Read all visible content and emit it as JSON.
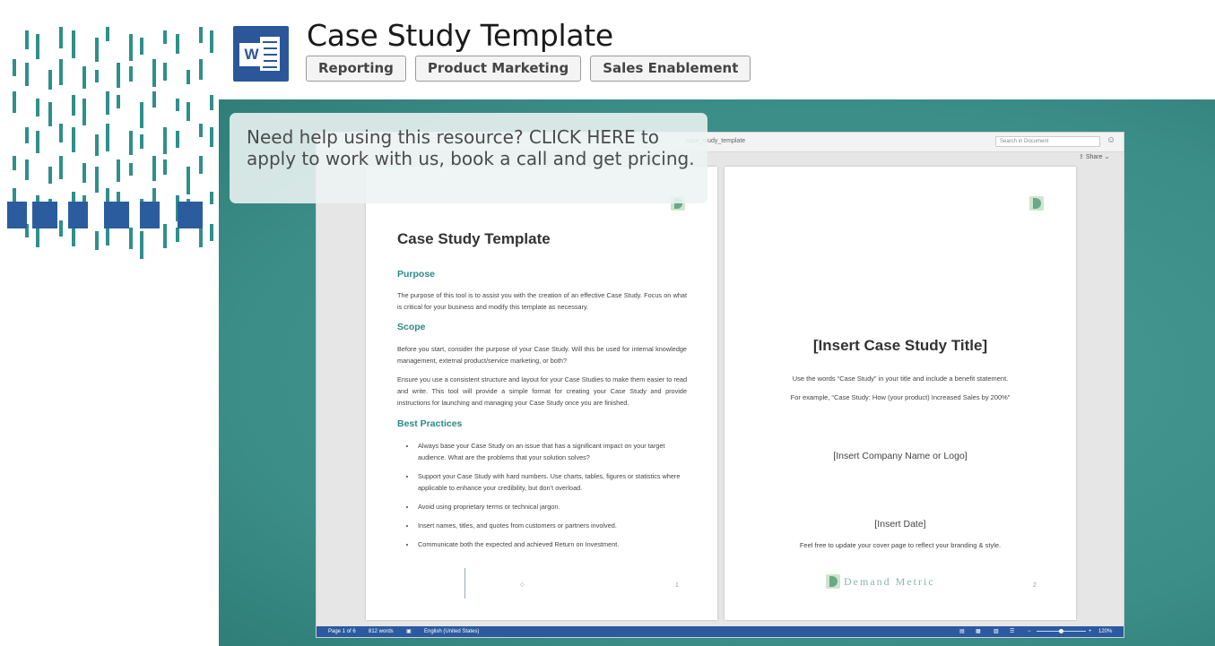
{
  "header": {
    "title": "Case Study Template",
    "tags": [
      "Reporting",
      "Product Marketing",
      "Sales Enablement"
    ],
    "app_icon": "word-icon",
    "app_icon_letter": "W"
  },
  "colors": {
    "accent_teal": "#3b8d87",
    "word_blue": "#2b579a",
    "heading_teal": "#2a8a86"
  },
  "help_overlay": {
    "text": "Need help using this resource? CLICK HERE to apply to work with us, book a call and get pricing."
  },
  "word_window": {
    "file_name": "case_study_template",
    "search_placeholder": "Search in Document",
    "share_label": "Share",
    "page1": {
      "title": "Case Study Template",
      "purpose_heading": "Purpose",
      "purpose_text": "The purpose of this tool is to assist you with the creation of an effective Case Study.  Focus on what is critical for your business and modify this template as necessary.",
      "scope_heading": "Scope",
      "scope_text_1": "Before you start, consider the purpose of your Case Study.  Will this be used for internal knowledge management, external product/service marketing, or both?",
      "scope_text_2": "Ensure you use a consistent structure and layout for your Case Studies to make them easier to read and write. This tool will provide a simple format for creating your Case Study and provide instructions for launching and managing your Case Study once you are finished.",
      "best_practices_heading": "Best Practices",
      "bullets": [
        "Always base your Case Study on an issue that has a significant impact on your target audience.  What are the problems that your solution solves?",
        "Support your Case Study with hard numbers.  Use charts, tables, figures or statistics where applicable to enhance your credibility, but don’t overload.",
        "Avoid using proprietary terms or technical jargon.",
        "Insert names, titles, and quotes from customers or partners involved.",
        "Communicate both the expected and achieved Return on Investment."
      ],
      "page_number": "1"
    },
    "page2": {
      "title": "[Insert Case Study Title]",
      "line1": "Use the words “Case Study” in your title and include a benefit statement.",
      "line2": "For example, “Case Study: How (your product) Increased Sales by 200%”",
      "company": "[Insert Company Name or Logo]",
      "date": "[Insert Date]",
      "footer_note": "Feel free to update your cover page to reflect your branding & style.",
      "logo_text": "Demand Metric",
      "page_number": "2"
    },
    "status_bar": {
      "page": "Page 1 of 6",
      "words": "812 words",
      "language": "English (United States)",
      "zoom": "120%",
      "zoom_level_percent": 120
    }
  }
}
